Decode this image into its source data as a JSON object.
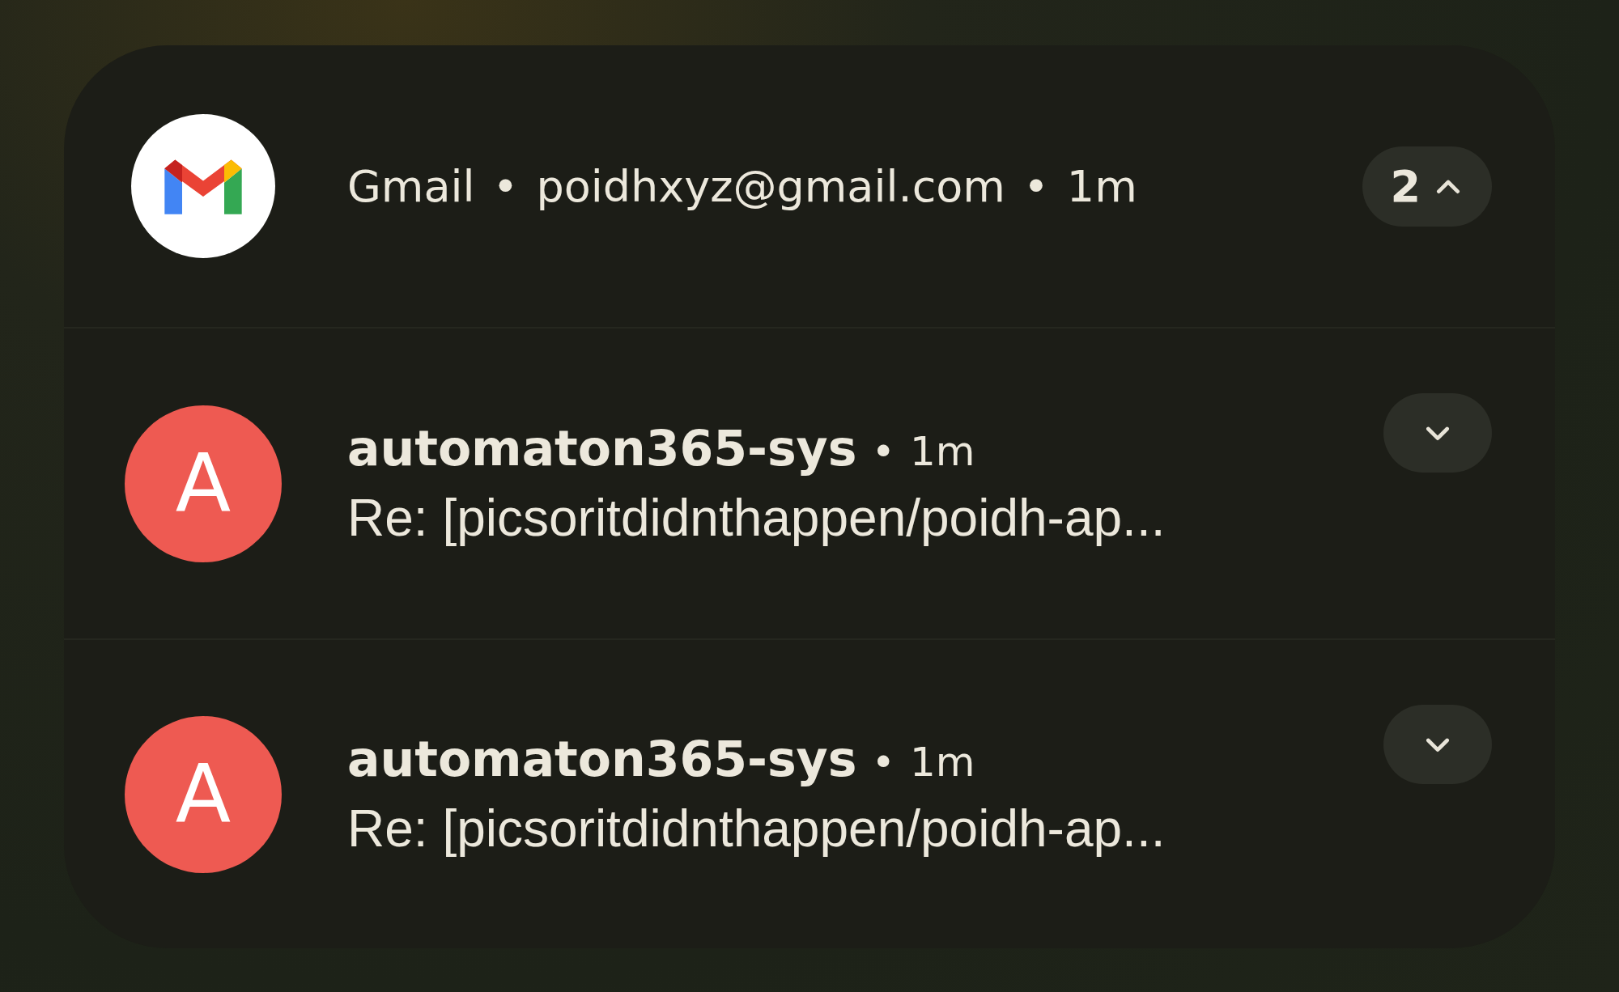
{
  "header": {
    "app": "Gmail",
    "separator": "•",
    "account": "poidhxyz@gmail.com",
    "time": "1m",
    "count": "2",
    "expanded": true
  },
  "messages": [
    {
      "avatar_letter": "A",
      "sender": "automaton365-sys",
      "separator": "•",
      "time": "1m",
      "subject": "Re: [picsoritdidnthappen/poidh-ap...",
      "expanded": false
    },
    {
      "avatar_letter": "A",
      "sender": "automaton365-sys",
      "separator": "•",
      "time": "1m",
      "subject": "Re: [picsoritdidnthappen/poidh-ap...",
      "expanded": false
    }
  ]
}
